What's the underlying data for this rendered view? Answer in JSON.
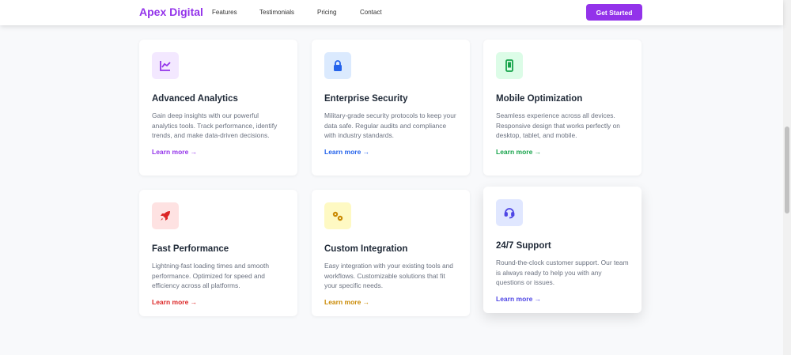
{
  "header": {
    "logo": "Apex Digital",
    "nav": [
      "Features",
      "Testimonials",
      "Pricing",
      "Contact"
    ],
    "cta": "Get Started"
  },
  "features": [
    {
      "title": "Advanced Analytics",
      "desc": "Gain deep insights with our powerful analytics tools. Track performance, identify trends, and make data-driven decisions.",
      "link": "Learn more →",
      "icon": "chart-line-icon",
      "color": "#9333ea",
      "bg": "#f3e8ff"
    },
    {
      "title": "Enterprise Security",
      "desc": "Military-grade security protocols to keep your data safe. Regular audits and compliance with industry standards.",
      "link": "Learn more →",
      "icon": "lock-icon",
      "color": "#2563eb",
      "bg": "#dbeafe"
    },
    {
      "title": "Mobile Optimization",
      "desc": "Seamless experience across all devices. Responsive design that works perfectly on desktop, tablet, and mobile.",
      "link": "Learn more →",
      "icon": "mobile-icon",
      "color": "#16a34a",
      "bg": "#dcfce7"
    },
    {
      "title": "Fast Performance",
      "desc": "Lightning-fast loading times and smooth performance. Optimized for speed and efficiency across all platforms.",
      "link": "Learn more →",
      "icon": "rocket-icon",
      "color": "#dc2626",
      "bg": "#fee2e2"
    },
    {
      "title": "Custom Integration",
      "desc": "Easy integration with your existing tools and workflows. Customizable solutions that fit your specific needs.",
      "link": "Learn more →",
      "icon": "cogs-icon",
      "color": "#ca8a04",
      "bg": "#fef9c3"
    },
    {
      "title": "24/7 Support",
      "desc": "Round-the-clock customer support. Our team is always ready to help you with any questions or issues.",
      "link": "Learn more →",
      "icon": "headset-icon",
      "color": "#4f46e5",
      "bg": "#e0e7ff"
    }
  ]
}
